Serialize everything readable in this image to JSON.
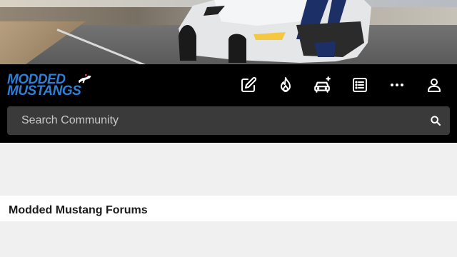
{
  "site": {
    "logo_line1": "MODDED",
    "logo_line2": "MUSTANGS"
  },
  "nav": {
    "icons": [
      "compose-icon",
      "fire-icon",
      "garage-car-icon",
      "list-icon",
      "more-icon",
      "user-icon"
    ]
  },
  "search": {
    "placeholder": "Search Community"
  },
  "page": {
    "title": "Modded Mustang Forums"
  },
  "colors": {
    "header_bg": "#000000",
    "search_bg": "#3a3a3a",
    "logo_blue": "#2f7fd6",
    "page_bg": "#f0f0f0"
  }
}
